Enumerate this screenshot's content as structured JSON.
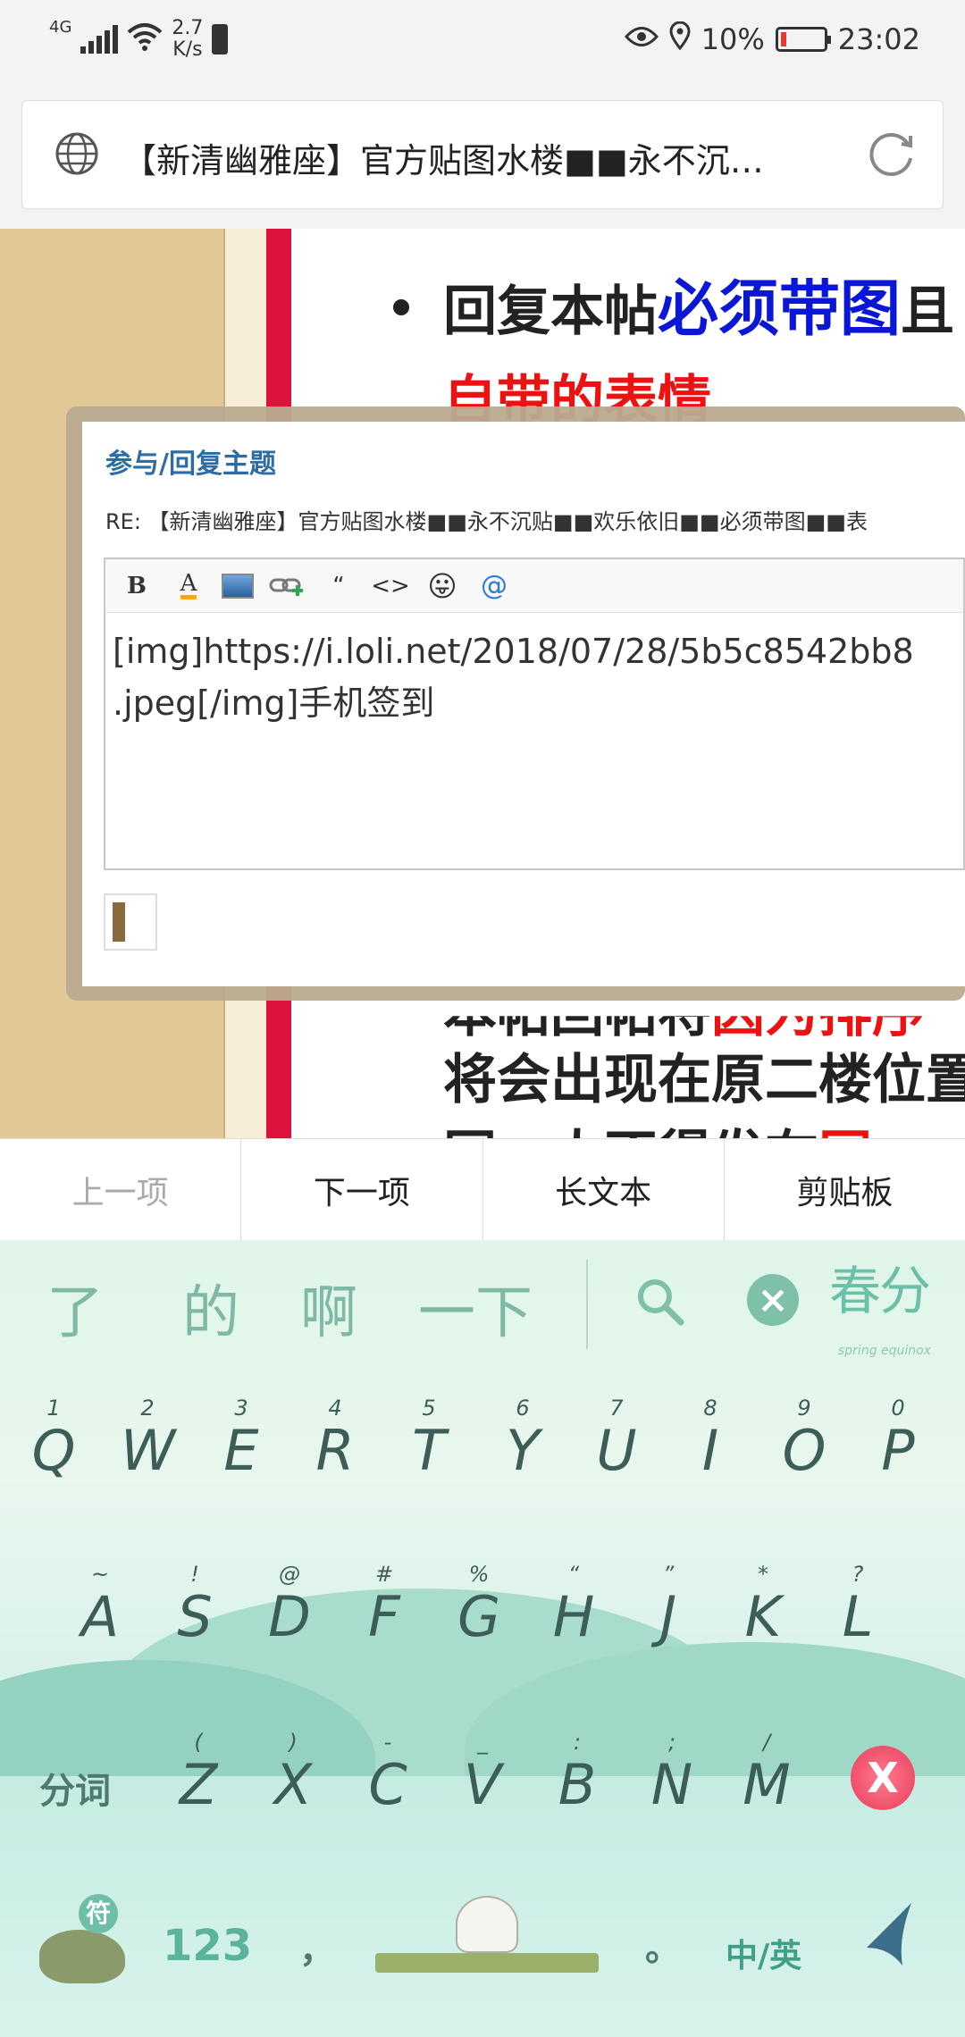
{
  "status_bar": {
    "network": "4G",
    "speed_value": "2.7",
    "speed_unit": "K/s",
    "battery_percent": "10%",
    "time": "23:02"
  },
  "url_bar": {
    "title": "【新清幽雅座】官方贴图水楼■■永不沉…"
  },
  "web": {
    "line1_prefix": "回复本帖",
    "line1_highlight": "必须带图",
    "line1_suffix": "且",
    "line2": "自带的表情",
    "line3": "本帖回帖将",
    "line3_red": "因为排序",
    "line4": "将会出现在原二楼位置",
    "line5": "同一人不得发在",
    "line5_red": "同一"
  },
  "reply_dialog": {
    "title": "参与/回复主题",
    "subject": "RE: 【新清幽雅座】官方贴图水楼■■永不沉贴■■欢乐依旧■■必须带图■■表",
    "toolbar_icons": [
      "bold-icon",
      "font-color-icon",
      "image-icon",
      "link-icon",
      "quote-icon",
      "code-icon",
      "emoji-icon",
      "mention-icon"
    ],
    "toolbar_glyphs": {
      "bold": "B",
      "color": "A",
      "quote": "“",
      "code": "<>",
      "emoji": "😛",
      "at": "@"
    },
    "editor_text": "[img]https://i.loli.net/2018/07/28/5b5c8542bb8\n.jpeg[/img]手机签到"
  },
  "helper_bar": {
    "items": [
      "上一项",
      "下一项",
      "长文本",
      "剪贴板"
    ]
  },
  "keyboard": {
    "candidates": [
      "了",
      "的",
      "啊",
      "一下"
    ],
    "brand": "春分",
    "brand_sub": "spring equinox",
    "row1": [
      {
        "hint": "1",
        "key": "Q"
      },
      {
        "hint": "2",
        "key": "W"
      },
      {
        "hint": "3",
        "key": "E"
      },
      {
        "hint": "4",
        "key": "R"
      },
      {
        "hint": "5",
        "key": "T"
      },
      {
        "hint": "6",
        "key": "Y"
      },
      {
        "hint": "7",
        "key": "U"
      },
      {
        "hint": "8",
        "key": "I"
      },
      {
        "hint": "9",
        "key": "O"
      },
      {
        "hint": "0",
        "key": "P"
      }
    ],
    "row2": [
      {
        "hint": "~",
        "key": "A"
      },
      {
        "hint": "!",
        "key": "S"
      },
      {
        "hint": "@",
        "key": "D"
      },
      {
        "hint": "#",
        "key": "F"
      },
      {
        "hint": "%",
        "key": "G"
      },
      {
        "hint": "“",
        "key": "H"
      },
      {
        "hint": "”",
        "key": "J"
      },
      {
        "hint": "*",
        "key": "K"
      },
      {
        "hint": "?",
        "key": "L"
      }
    ],
    "row3": [
      {
        "hint": "(",
        "key": "Z"
      },
      {
        "hint": ")",
        "key": "X"
      },
      {
        "hint": "-",
        "key": "C"
      },
      {
        "hint": "_",
        "key": "V"
      },
      {
        "hint": ":",
        "key": "B"
      },
      {
        "hint": ";",
        "key": "N"
      },
      {
        "hint": "/",
        "key": "M"
      }
    ],
    "segment_label": "分词",
    "symbol_label": "符",
    "number_label": "123",
    "comma": "，",
    "period": "。",
    "lang_label": "中/英",
    "delete_glyph": "X"
  }
}
